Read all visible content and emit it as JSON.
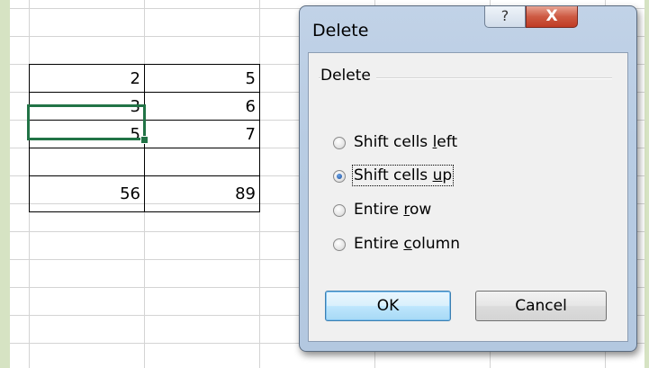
{
  "spreadsheet": {
    "rows": [
      {
        "a": "2",
        "b": "5"
      },
      {
        "a": "3",
        "b": "6"
      },
      {
        "a": "5",
        "b": "7"
      },
      {
        "a": "56",
        "b": "89"
      }
    ],
    "selected_cell": "3",
    "selection_color": "#217346"
  },
  "dialog": {
    "title": "Delete",
    "help_icon": "?",
    "close_icon": "X",
    "group_label": "Delete",
    "options": [
      {
        "pre": "Shift cells ",
        "key": "l",
        "post": "eft",
        "checked": false
      },
      {
        "pre": "Shift cells ",
        "key": "u",
        "post": "p",
        "checked": true
      },
      {
        "pre": "Entire ",
        "key": "r",
        "post": "ow",
        "checked": false
      },
      {
        "pre": "Entire ",
        "key": "c",
        "post": "olumn",
        "checked": false
      }
    ],
    "ok_label": "OK",
    "cancel_label": "Cancel"
  }
}
